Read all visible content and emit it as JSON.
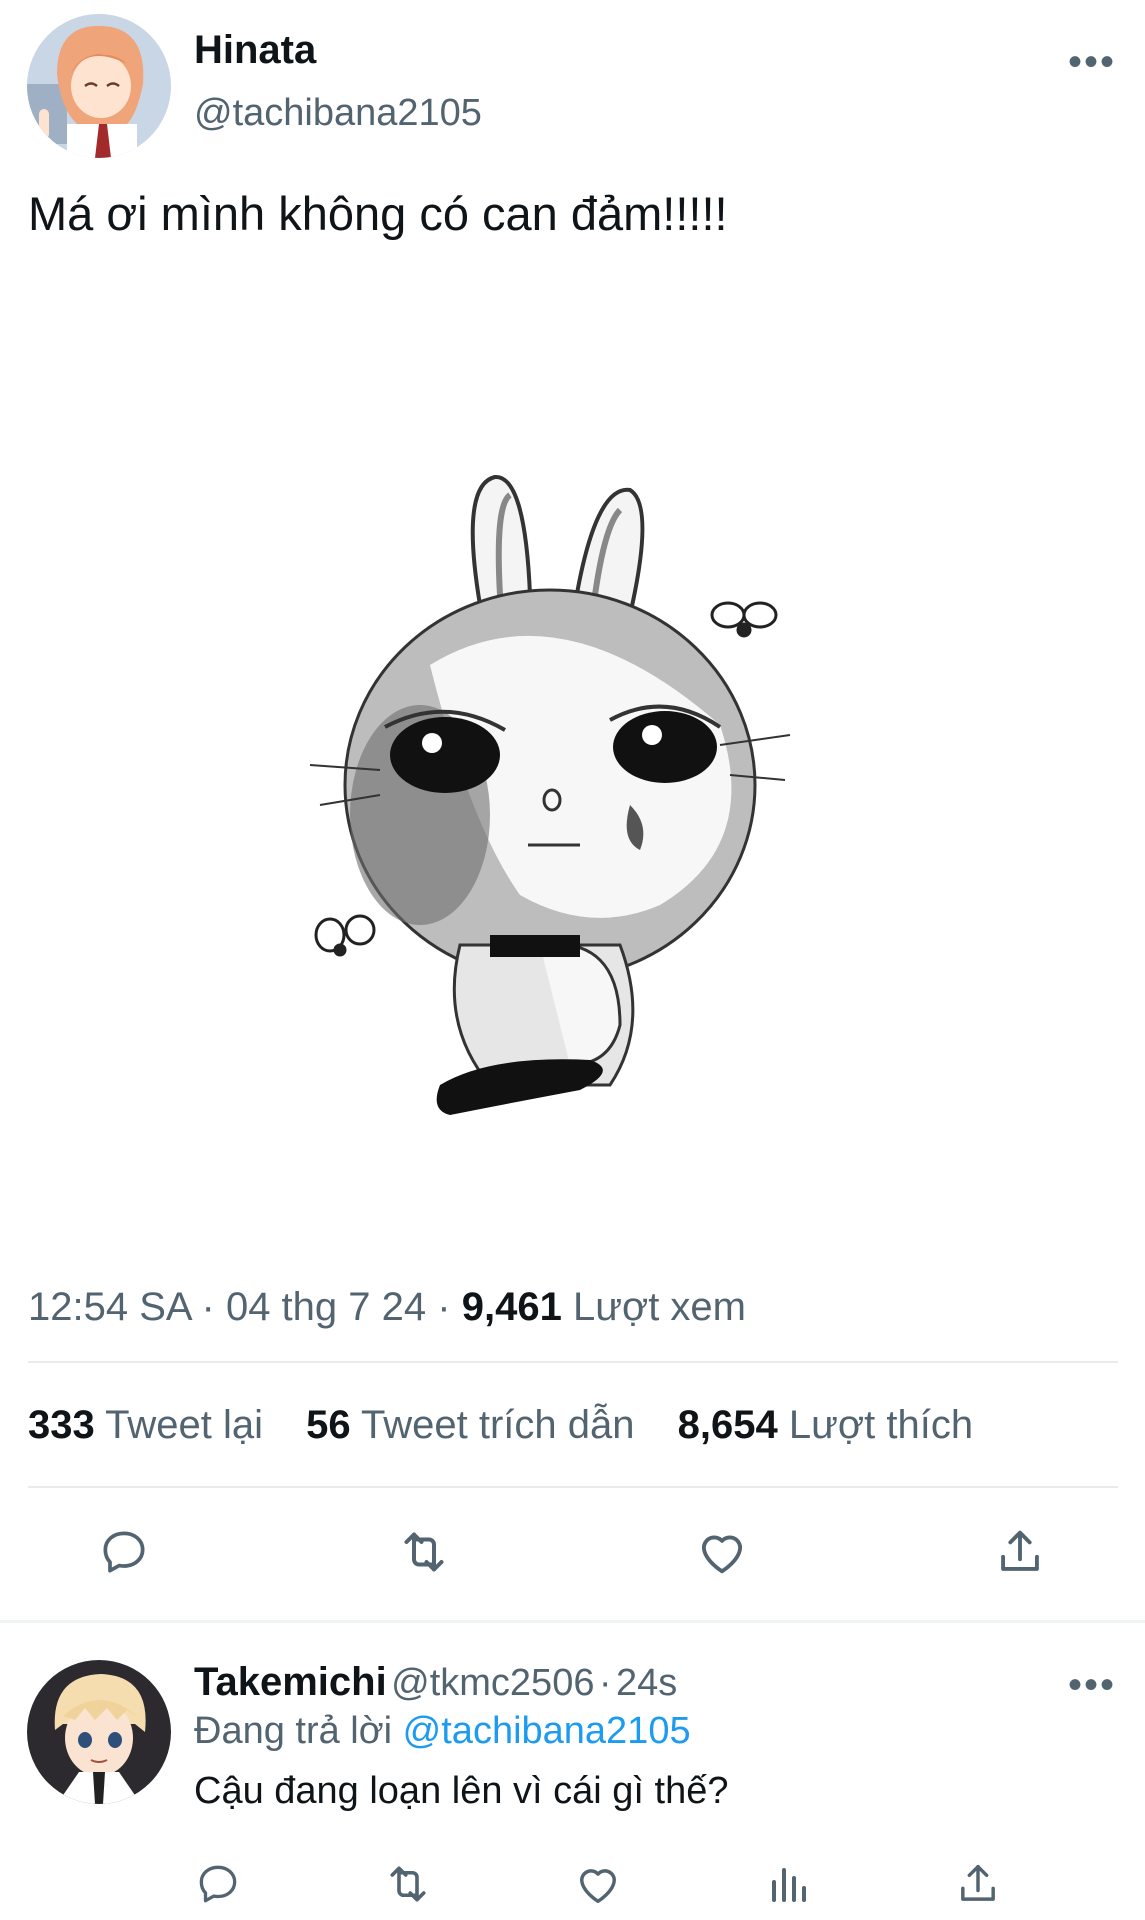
{
  "tweet": {
    "author": {
      "name": "Hinata",
      "handle": "@tachibana2105"
    },
    "more_label": "•••",
    "text": "Má ơi mình không có can đảm!!!!!",
    "meta": {
      "time": "12:54 SA",
      "sep": "·",
      "date": "04 thg 7 24",
      "views_count": "9,461",
      "views_label": "Lượt xem"
    },
    "stats": {
      "retweets_count": "333",
      "retweets_label": "Tweet lại",
      "quotes_count": "56",
      "quotes_label": "Tweet trích dẫn",
      "likes_count": "8,654",
      "likes_label": "Lượt thích"
    },
    "actions": [
      "reply-icon",
      "retweet-icon",
      "like-icon",
      "share-icon"
    ]
  },
  "reply": {
    "name": "Takemichi",
    "handle": "@tkmc2506",
    "sep": "·",
    "time": "24s",
    "replying_prefix": "Đang trả lời",
    "replying_to": "@tachibana2105",
    "text": "Cậu đang loạn lên vì cái gì thế?",
    "more_label": "•••",
    "actions": [
      "reply-icon",
      "retweet-icon",
      "like-icon",
      "views-icon",
      "share-icon"
    ]
  },
  "colors": {
    "link": "#1d9bf0",
    "secondary_text": "#536471",
    "primary_text": "#0f1419"
  }
}
